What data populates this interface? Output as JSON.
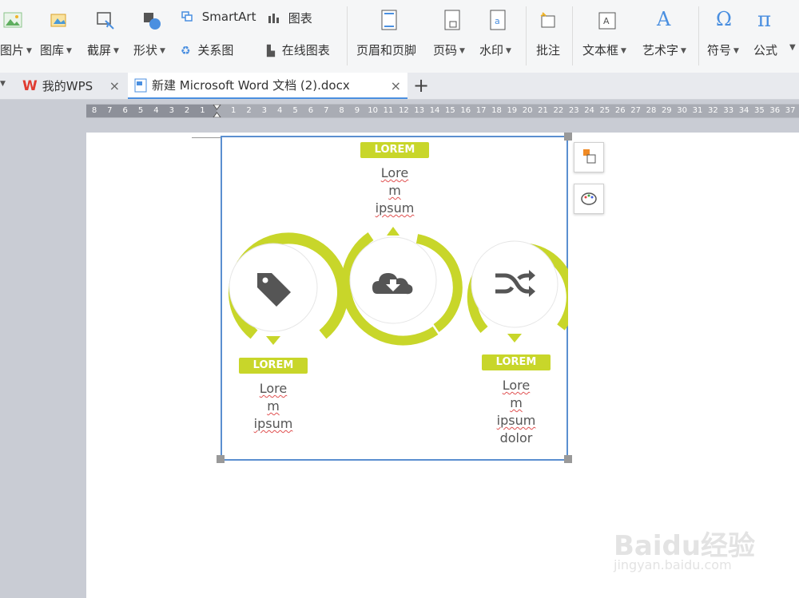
{
  "ribbon": {
    "row1": {
      "smartart": "SmartArt",
      "chart": "图表"
    },
    "row2": {
      "picture": "图片",
      "gallery": "图库",
      "screenshot": "截屏",
      "shapes": "形状",
      "relation": "关系图",
      "online_chart": "在线图表",
      "header_footer": "页眉和页脚",
      "page_number": "页码",
      "watermark": "水印",
      "comment": "批注",
      "textbox": "文本框",
      "wordart": "艺术字",
      "symbol": "符号",
      "formula": "公式"
    },
    "symbol_glyph": "Ω",
    "formula_glyph": "π",
    "wordart_glyph": "A"
  },
  "tabs": [
    {
      "label": "我的WPS"
    },
    {
      "label": "新建 Microsoft Word 文档 (2).docx"
    }
  ],
  "new_tab": "+",
  "ruler": {
    "numbers": [
      "8",
      "7",
      "6",
      "5",
      "4",
      "3",
      "2",
      "1",
      "",
      "1",
      "2",
      "3",
      "4",
      "5",
      "6",
      "7",
      "8",
      "9",
      "10",
      "11",
      "12",
      "13",
      "14",
      "15",
      "16",
      "17",
      "18",
      "19",
      "20",
      "21",
      "22",
      "23",
      "24",
      "25",
      "26",
      "27",
      "28",
      "29",
      "30",
      "31",
      "32",
      "33",
      "34",
      "35",
      "36",
      "37"
    ]
  },
  "infographic": {
    "top": {
      "badge": "LOREM",
      "text": [
        "Lore",
        "m",
        "ipsum"
      ]
    },
    "left": {
      "badge": "LOREM",
      "text": [
        "Lore",
        "m",
        "ipsum"
      ]
    },
    "right": {
      "badge": "LOREM",
      "text": [
        "Lore",
        "m",
        "ipsum",
        "dolor"
      ]
    },
    "accent": "#c8d62a",
    "icons": [
      "tag-icon",
      "cloud-download-icon",
      "shuffle-icon"
    ]
  },
  "watermark": {
    "brand": "Baidu经验",
    "url": "jingyan.baidu.com"
  }
}
